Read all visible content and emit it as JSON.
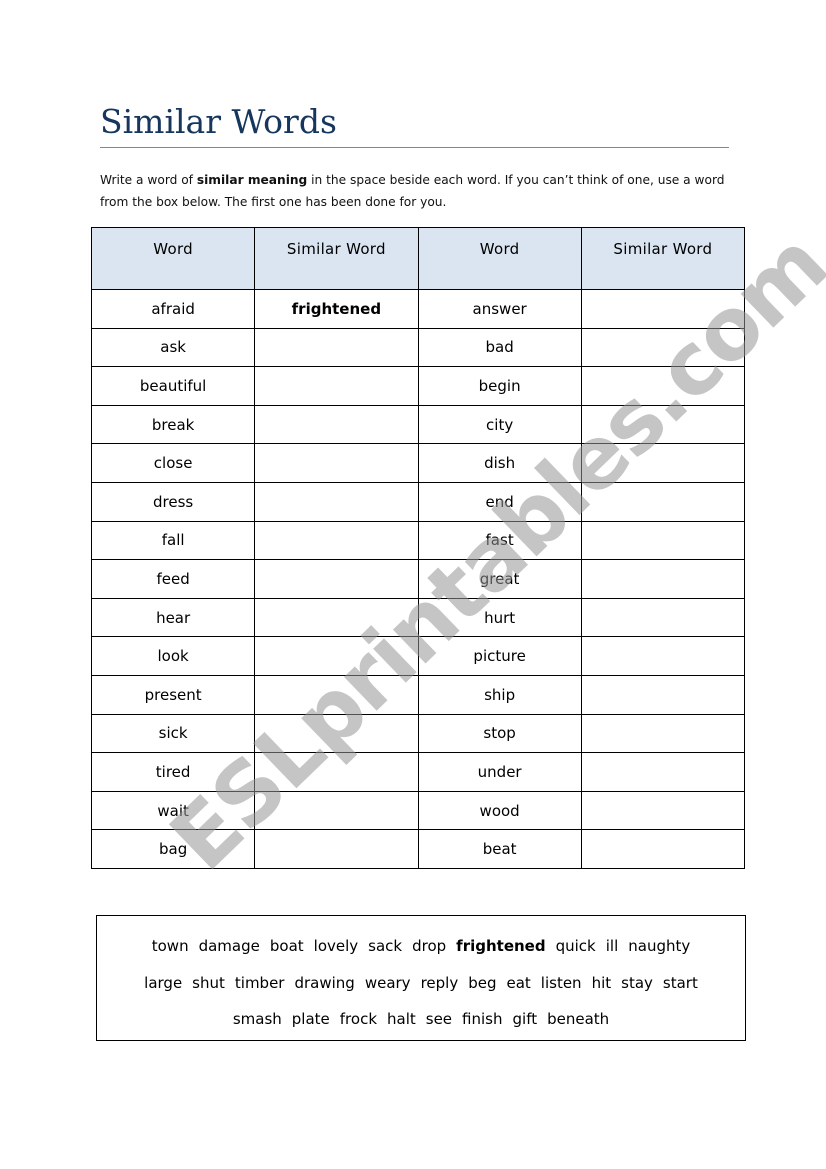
{
  "title": "Similar Words",
  "instructions": {
    "part1": "Write a word of ",
    "bold": "similar meaning",
    "part2": " in the space beside each word. If you can’t think of one, use a word from the box below. The first one has been done for you."
  },
  "table": {
    "headers": [
      "Word",
      "Similar Word",
      "Word",
      "Similar Word"
    ],
    "rows": [
      {
        "word1": "afraid",
        "similar1": "frightened",
        "word2": "answer",
        "similar2": ""
      },
      {
        "word1": "ask",
        "similar1": "",
        "word2": "bad",
        "similar2": ""
      },
      {
        "word1": "beautiful",
        "similar1": "",
        "word2": "begin",
        "similar2": ""
      },
      {
        "word1": "break",
        "similar1": "",
        "word2": "city",
        "similar2": ""
      },
      {
        "word1": "close",
        "similar1": "",
        "word2": "dish",
        "similar2": ""
      },
      {
        "word1": "dress",
        "similar1": "",
        "word2": "end",
        "similar2": ""
      },
      {
        "word1": "fall",
        "similar1": "",
        "word2": "fast",
        "similar2": ""
      },
      {
        "word1": "feed",
        "similar1": "",
        "word2": "great",
        "similar2": ""
      },
      {
        "word1": "hear",
        "similar1": "",
        "word2": "hurt",
        "similar2": ""
      },
      {
        "word1": "look",
        "similar1": "",
        "word2": "picture",
        "similar2": ""
      },
      {
        "word1": "present",
        "similar1": "",
        "word2": "ship",
        "similar2": ""
      },
      {
        "word1": "sick",
        "similar1": "",
        "word2": "stop",
        "similar2": ""
      },
      {
        "word1": "tired",
        "similar1": "",
        "word2": "under",
        "similar2": ""
      },
      {
        "word1": "wait",
        "similar1": "",
        "word2": "wood",
        "similar2": ""
      },
      {
        "word1": "bag",
        "similar1": "",
        "word2": "beat",
        "similar2": ""
      }
    ]
  },
  "word_box": {
    "lines": [
      [
        "town",
        "damage",
        "boat",
        "lovely",
        "sack",
        "drop",
        "frightened",
        "quick",
        "ill",
        "naughty"
      ],
      [
        "large",
        "shut",
        "timber",
        "drawing",
        "weary",
        "reply",
        "beg",
        "eat",
        "listen",
        "hit",
        "stay",
        "start"
      ],
      [
        "smash",
        "plate",
        "frock",
        "halt",
        "see",
        "finish",
        "gift",
        "beneath"
      ]
    ],
    "bold_words": [
      "frightened"
    ]
  },
  "watermark": "ESLprintables.com",
  "colors": {
    "title": "#17365d",
    "rule": "#6b8bb0",
    "header_bg": "#dbe5f1",
    "watermark": "#969696"
  }
}
